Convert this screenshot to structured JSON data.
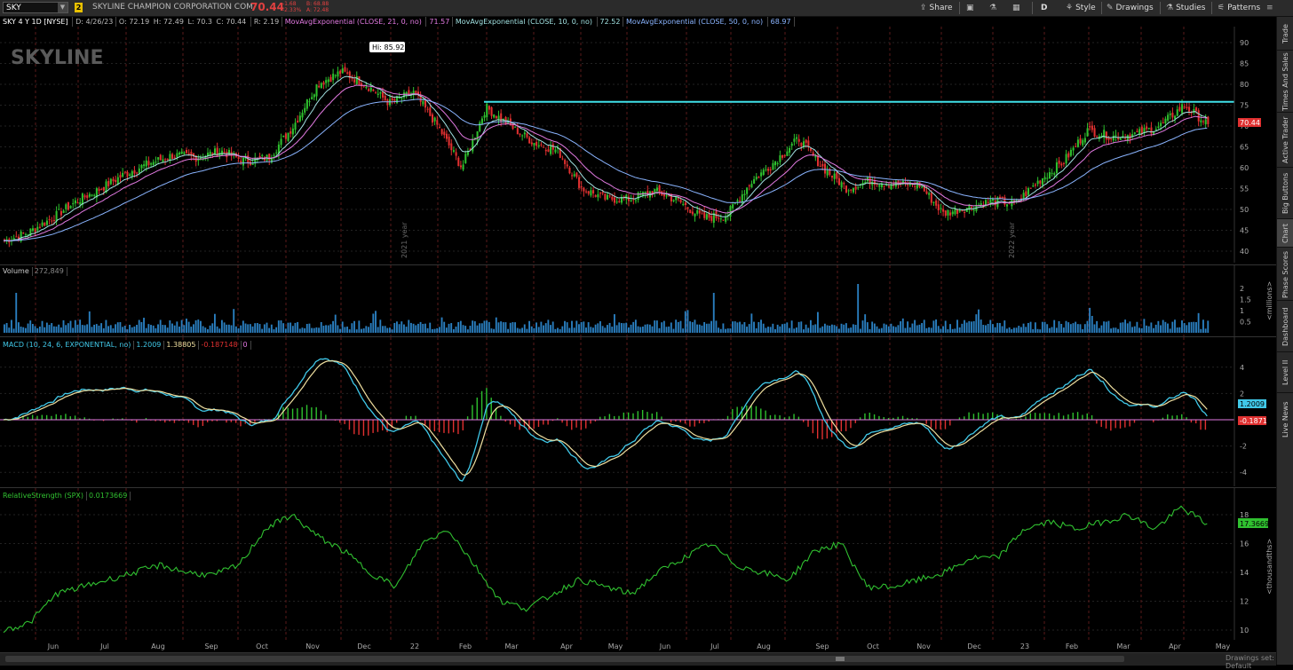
{
  "toolbar": {
    "symbol": "SKY",
    "link_badge": "2",
    "company": "SKYLINE CHAMPION CORPORATION COM",
    "last": "70.44",
    "change_abs": "-1.68",
    "change_pct": "-2.33%",
    "bid": "B: 68.88",
    "ask": "A: 72.48",
    "buttons": {
      "share": "Share",
      "d": "D",
      "style": "Style",
      "drawings": "Drawings",
      "studies": "Studies",
      "patterns": "Patterns"
    }
  },
  "info": {
    "symbol_period": "SKY 4 Y 1D [NYSE]",
    "date": "D: 4/26/23",
    "open": "O: 72.19",
    "high": "H: 72.49",
    "low": "L: 70.3",
    "close": "C: 70.44",
    "range": "R: 2.19",
    "ema21_label": "MovAvgExponential (CLOSE, 21, 0, no)",
    "ema21_val": "71.57",
    "ema10_label": "MovAvgExponential (CLOSE, 10, 0, no)",
    "ema10_val": "72.52",
    "ema50_label": "MovAvgExponential (CLOSE, 50, 0, no)",
    "ema50_val": "68.97"
  },
  "price_pane": {
    "watermark": "SKYLINE",
    "hi_label": "Hi: 85.92",
    "last_badge": "70.44",
    "y_ticks": [
      "90",
      "85",
      "80",
      "75",
      "70",
      "65",
      "60",
      "55",
      "50",
      "45",
      "40"
    ],
    "year_labels": [
      "2021 year",
      "2022 year"
    ],
    "resistance_level": 75.8
  },
  "volume_pane": {
    "title": "Volume",
    "value": "272,849",
    "y_ticks": [
      "2",
      "1.5",
      "1",
      "0.5"
    ],
    "unit": "<millions>"
  },
  "macd_pane": {
    "title": "MACD (10, 24, 6, EXPONENTIAL, no)",
    "value": "1.2009",
    "avg": "1.38805",
    "diff": "-0.187148",
    "zero": "0",
    "badge_value": "1.2009",
    "badge_diff": "-0.1871",
    "y_ticks": [
      "4",
      "2",
      "-2",
      "-4"
    ]
  },
  "rs_pane": {
    "title": "RelativeStrength (SPX)",
    "value": "0.0173669",
    "badge": "17.3669",
    "y_ticks": [
      "18",
      "16",
      "14",
      "12",
      "10"
    ],
    "unit": "<thousandths>"
  },
  "x_axis": {
    "months": [
      "Jun",
      "Jul",
      "Aug",
      "Sep",
      "Oct",
      "Nov",
      "Dec",
      "22",
      "Feb",
      "Mar",
      "Apr",
      "May",
      "Jun",
      "Jul",
      "Aug",
      "Sep",
      "Oct",
      "Nov",
      "Dec",
      "23",
      "Feb",
      "Mar",
      "Apr",
      "May"
    ]
  },
  "right_tabs": [
    "Trade",
    "Times And Sales",
    "Active Trader",
    "Big Buttons",
    "Chart",
    "Phase Scores",
    "Dashboard",
    "Level II",
    "Live News"
  ],
  "status": {
    "drawing_set": "Drawings set: Default"
  },
  "colors": {
    "up": "#2ec02e",
    "down": "#e03030",
    "ema10": "#e27ae2",
    "ema21": "#a0e0e0",
    "ema50": "#8ab4ff",
    "resistance": "#40e0e8",
    "volume": "#2a7fc0",
    "macd": "#40c8e8",
    "macd_avg": "#f0e0a0",
    "rs": "#30c030"
  },
  "chart_data": {
    "type": "candlestick",
    "series": [
      {
        "name": "SKY",
        "approx_close": [
          42.5,
          44.5,
          48.0,
          52.0,
          55.0,
          58.5,
          61.0,
          63.0,
          62.5,
          64.0,
          61.5,
          62.5,
          70.0,
          80.0,
          83.0,
          80.0,
          75.5,
          78.0,
          70.0,
          60.0,
          74.5,
          70.0,
          66.0,
          64.0,
          55.0,
          52.5,
          52.5,
          54.5,
          52.0,
          48.0,
          48.5,
          56.5,
          61.5,
          67.0,
          60.0,
          55.0,
          57.0,
          56.0,
          56.0,
          49.0,
          50.5,
          52.0,
          51.5,
          57.0,
          61.5,
          69.0,
          67.5,
          68.0,
          70.0,
          75.0,
          70.44
        ]
      },
      {
        "name": "RelativeStrength (SPX)",
        "approx_values": [
          10.0,
          10.5,
          12.5,
          13.0,
          13.5,
          14.0,
          14.5,
          14.0,
          13.8,
          14.5,
          17.0,
          18.0,
          16.5,
          15.5,
          14.0,
          13.0,
          16.0,
          17.0,
          14.5,
          12.0,
          11.5,
          12.5,
          13.5,
          13.0,
          12.5,
          14.0,
          15.0,
          16.0,
          14.5,
          14.0,
          13.5,
          15.5,
          16.0,
          13.0,
          13.0,
          13.5,
          14.0,
          15.0,
          15.0,
          17.0,
          17.5,
          17.0,
          17.5,
          18.0,
          17.0,
          18.5,
          17.37
        ]
      }
    ]
  }
}
